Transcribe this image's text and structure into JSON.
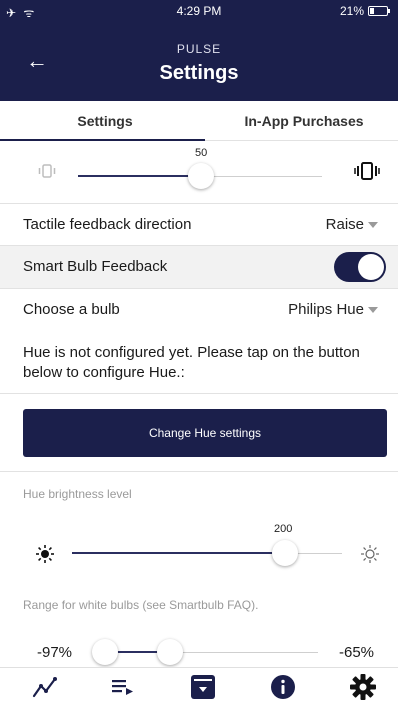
{
  "status_bar": {
    "left_icons": "✈ ᯤ",
    "time": "4:29 PM",
    "battery": "21%"
  },
  "header": {
    "back_icon": "←",
    "app_name": "PULSE",
    "title": "Settings"
  },
  "tabs": [
    {
      "label": "Settings",
      "active": true
    },
    {
      "label": "In-App Purchases",
      "active": false
    }
  ],
  "vibration_slider": {
    "value": "50",
    "value_fraction": 0.5,
    "left_icon": "vibrate-low-icon",
    "right_icon": "vibrate-high-icon"
  },
  "tactile": {
    "label": "Tactile feedback direction",
    "value": "Raise"
  },
  "smart_bulb": {
    "label": "Smart Bulb Feedback",
    "enabled": true
  },
  "bulb": {
    "label": "Choose a bulb",
    "value": "Philips Hue"
  },
  "message": "Hue is not configured yet. Please tap on the button below to configure Hue.:",
  "change_button": "Change Hue settings",
  "brightness": {
    "label": "Hue brightness level",
    "value": "200",
    "value_fraction": 0.78,
    "left_icon": "sun-dark-icon",
    "right_icon": "sun-light-icon"
  },
  "white_range": {
    "label": "Range for white bulbs (see Smartbulb FAQ).",
    "low": "-97%",
    "high": "-65%",
    "low_fraction": 0.0,
    "high_fraction": 0.29
  },
  "nav": [
    "graph-icon",
    "queue-icon",
    "archive-icon",
    "info-icon",
    "gear-icon"
  ],
  "colors": {
    "primary": "#1b1f4b",
    "divider": "#e2e2e2",
    "muted": "#9a9a9a"
  }
}
